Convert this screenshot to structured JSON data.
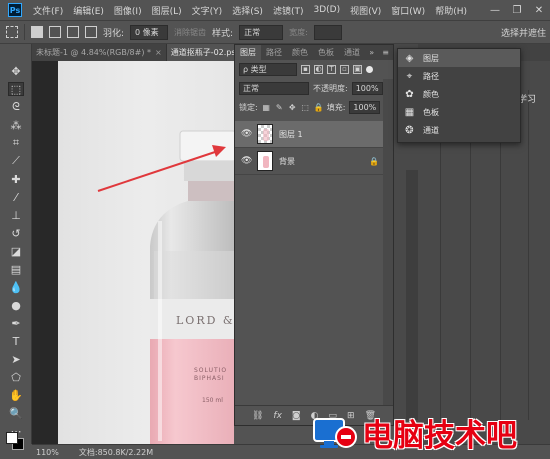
{
  "menubar": {
    "logo": "Ps",
    "items": [
      "文件(F)",
      "编辑(E)",
      "图像(I)",
      "图层(L)",
      "文字(Y)",
      "选择(S)",
      "滤镜(T)",
      "3D(D)",
      "视图(V)",
      "窗口(W)",
      "帮助(H)"
    ],
    "window_controls": [
      "—",
      "❐",
      "✕"
    ]
  },
  "options": {
    "feather_label": "羽化:",
    "feather_value": "0 像素",
    "antialias_label": "消除锯齿",
    "style_label": "样式:",
    "style_value": "正常",
    "width_label": "宽度:",
    "select_mask_label": "选择并遮住"
  },
  "doc_tabs": [
    {
      "label": "未标题-1 @ 4.84%(RGB/8#) *",
      "close": "×"
    },
    {
      "label": "通道抠瓶子-02.psd",
      "close": "×"
    }
  ],
  "photo": {
    "brand_text": "LORD & B",
    "label_line1": "SOLUTIO",
    "label_line2": "BIPHASI",
    "volume": "150 ml"
  },
  "status": {
    "zoom": "110%",
    "doc_info": "文档:850.8K/2.22M"
  },
  "layers_panel": {
    "tabs": [
      "图层",
      "路径",
      "颜色",
      "色板",
      "通道"
    ],
    "more_icon": "»",
    "menu_icon": "≡",
    "filter_kind": "ρ 类型",
    "blend_mode": "正常",
    "opacity_label": "不透明度:",
    "opacity_value": "100%",
    "lock_label": "锁定:",
    "fill_label": "填充:",
    "fill_value": "100%",
    "layers": [
      {
        "name": "图层 1",
        "visible": true,
        "selected": true
      },
      {
        "name": "背景",
        "visible": true,
        "selected": false,
        "locked": true
      }
    ],
    "footer_icons": [
      "link-icon",
      "fx-icon",
      "mask-icon",
      "adjustment-icon",
      "group-icon",
      "new-layer-icon",
      "trash-icon"
    ],
    "footer_fx": "fx"
  },
  "right_panel": {
    "learn_tab": "学习"
  },
  "float_menu": {
    "items": [
      {
        "label": "图层",
        "icon": "layers-icon"
      },
      {
        "label": "路径",
        "icon": "paths-icon"
      },
      {
        "label": "颜色",
        "icon": "color-icon"
      },
      {
        "label": "色板",
        "icon": "swatches-icon"
      },
      {
        "label": "通道",
        "icon": "channels-icon"
      }
    ]
  },
  "watermark": {
    "text": "电脑技术吧"
  },
  "colors": {
    "accent_red": "#e60012",
    "arrow_red": "#e0383c",
    "panel_bg": "#535353",
    "selected_layer": "#6b6b6b"
  }
}
